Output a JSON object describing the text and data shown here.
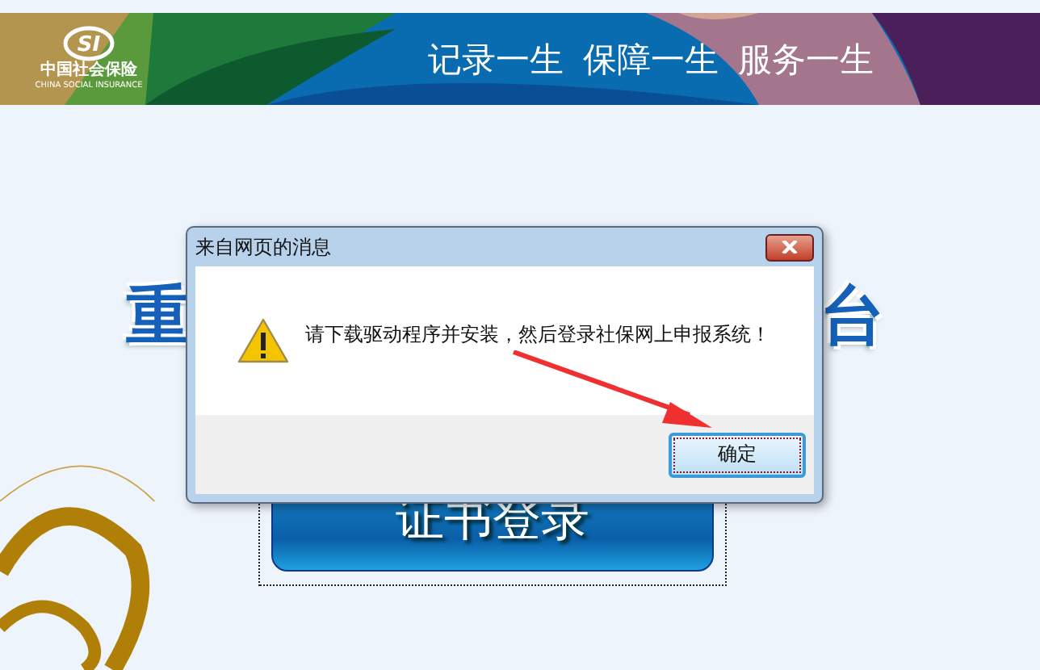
{
  "banner": {
    "logo": {
      "mark": "SI",
      "name_cn": "中国社会保险",
      "name_en": "CHINA SOCIAL INSURANCE"
    },
    "slogan": [
      "记录一生",
      "保障一生",
      "服务一生"
    ]
  },
  "heading": {
    "left": "重",
    "right": "台"
  },
  "login": {
    "button": "证书登录"
  },
  "dialog": {
    "title": "来自网页的消息",
    "message": "请下载驱动程序并安装，然后登录社保网上申报系统！",
    "buttons": [
      {
        "label": "确定",
        "focused": true
      }
    ]
  }
}
